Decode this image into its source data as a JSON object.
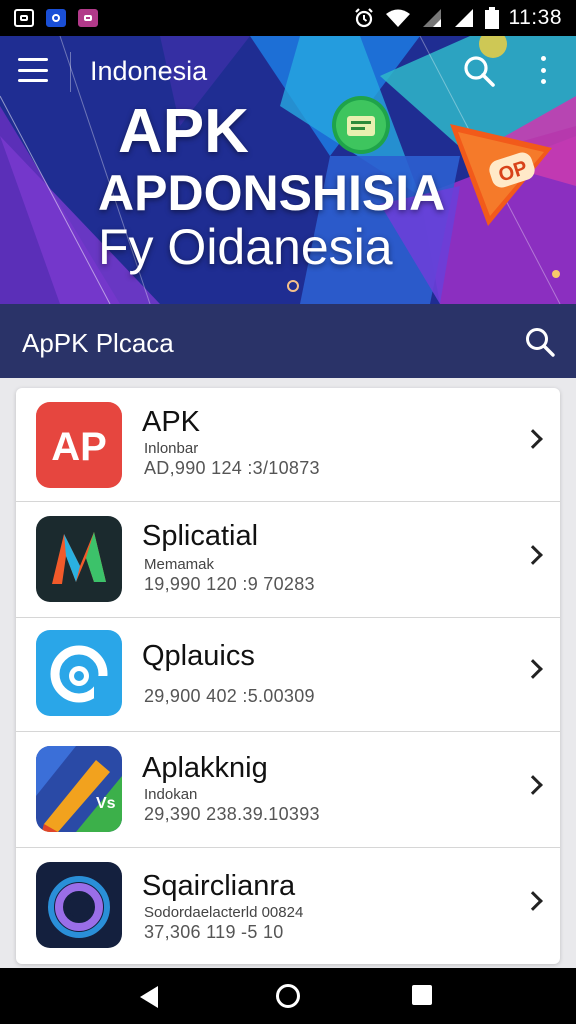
{
  "status_bar": {
    "time": "11:38",
    "icons": [
      "gallery-icon",
      "app-icon-blue",
      "app-icon-purple",
      "alarm-icon",
      "wifi-icon",
      "signal-icon",
      "signal-icon",
      "battery-icon"
    ]
  },
  "header": {
    "title": "Indonesia",
    "menu_icon": "hamburger-menu-icon",
    "search_icon": "search-icon",
    "more_icon": "more-vertical-icon"
  },
  "hero": {
    "line1": "APK",
    "line2": "APDONSHISIA",
    "line3": "Fy Oidanesia",
    "badge_text": "OP"
  },
  "search_band": {
    "label": "ApPK Plcaca",
    "search_icon": "search-icon"
  },
  "apps": [
    {
      "name": "APK",
      "sub": "Inlonbar",
      "meta": "AD,990   124 :3/10873",
      "icon": "ap-logo-icon",
      "icon_color": "#e03a37"
    },
    {
      "name": "Splicatial",
      "sub": "Memamak",
      "meta": "19,990   120 :9 70283",
      "icon": "n-logo-icon",
      "icon_color": "#1b2a2e"
    },
    {
      "name": "Qplauics",
      "sub": "",
      "meta": "29,900   402 :5.00309",
      "icon": "at-logo-icon",
      "icon_color": "#2aa6e8"
    },
    {
      "name": "Aplakknig",
      "sub": "Indokan",
      "meta": "29,390   238.39.10393",
      "icon": "pencil-logo-icon",
      "icon_color": "#2a4aa6"
    },
    {
      "name": "Sqairclianra",
      "sub": "Sodordaelacterld 00824",
      "meta": "37,306   119 -5 10",
      "icon": "ring-logo-icon",
      "icon_color": "#14203e"
    }
  ],
  "colors": {
    "hero_bg": "#1f2d92",
    "search_band": "#2a3368",
    "card_bg": "#ffffff",
    "page_bg": "#e9e9ec"
  },
  "nav_bar": {
    "back_icon": "back-icon",
    "home_icon": "home-icon",
    "recents_icon": "recents-icon"
  }
}
